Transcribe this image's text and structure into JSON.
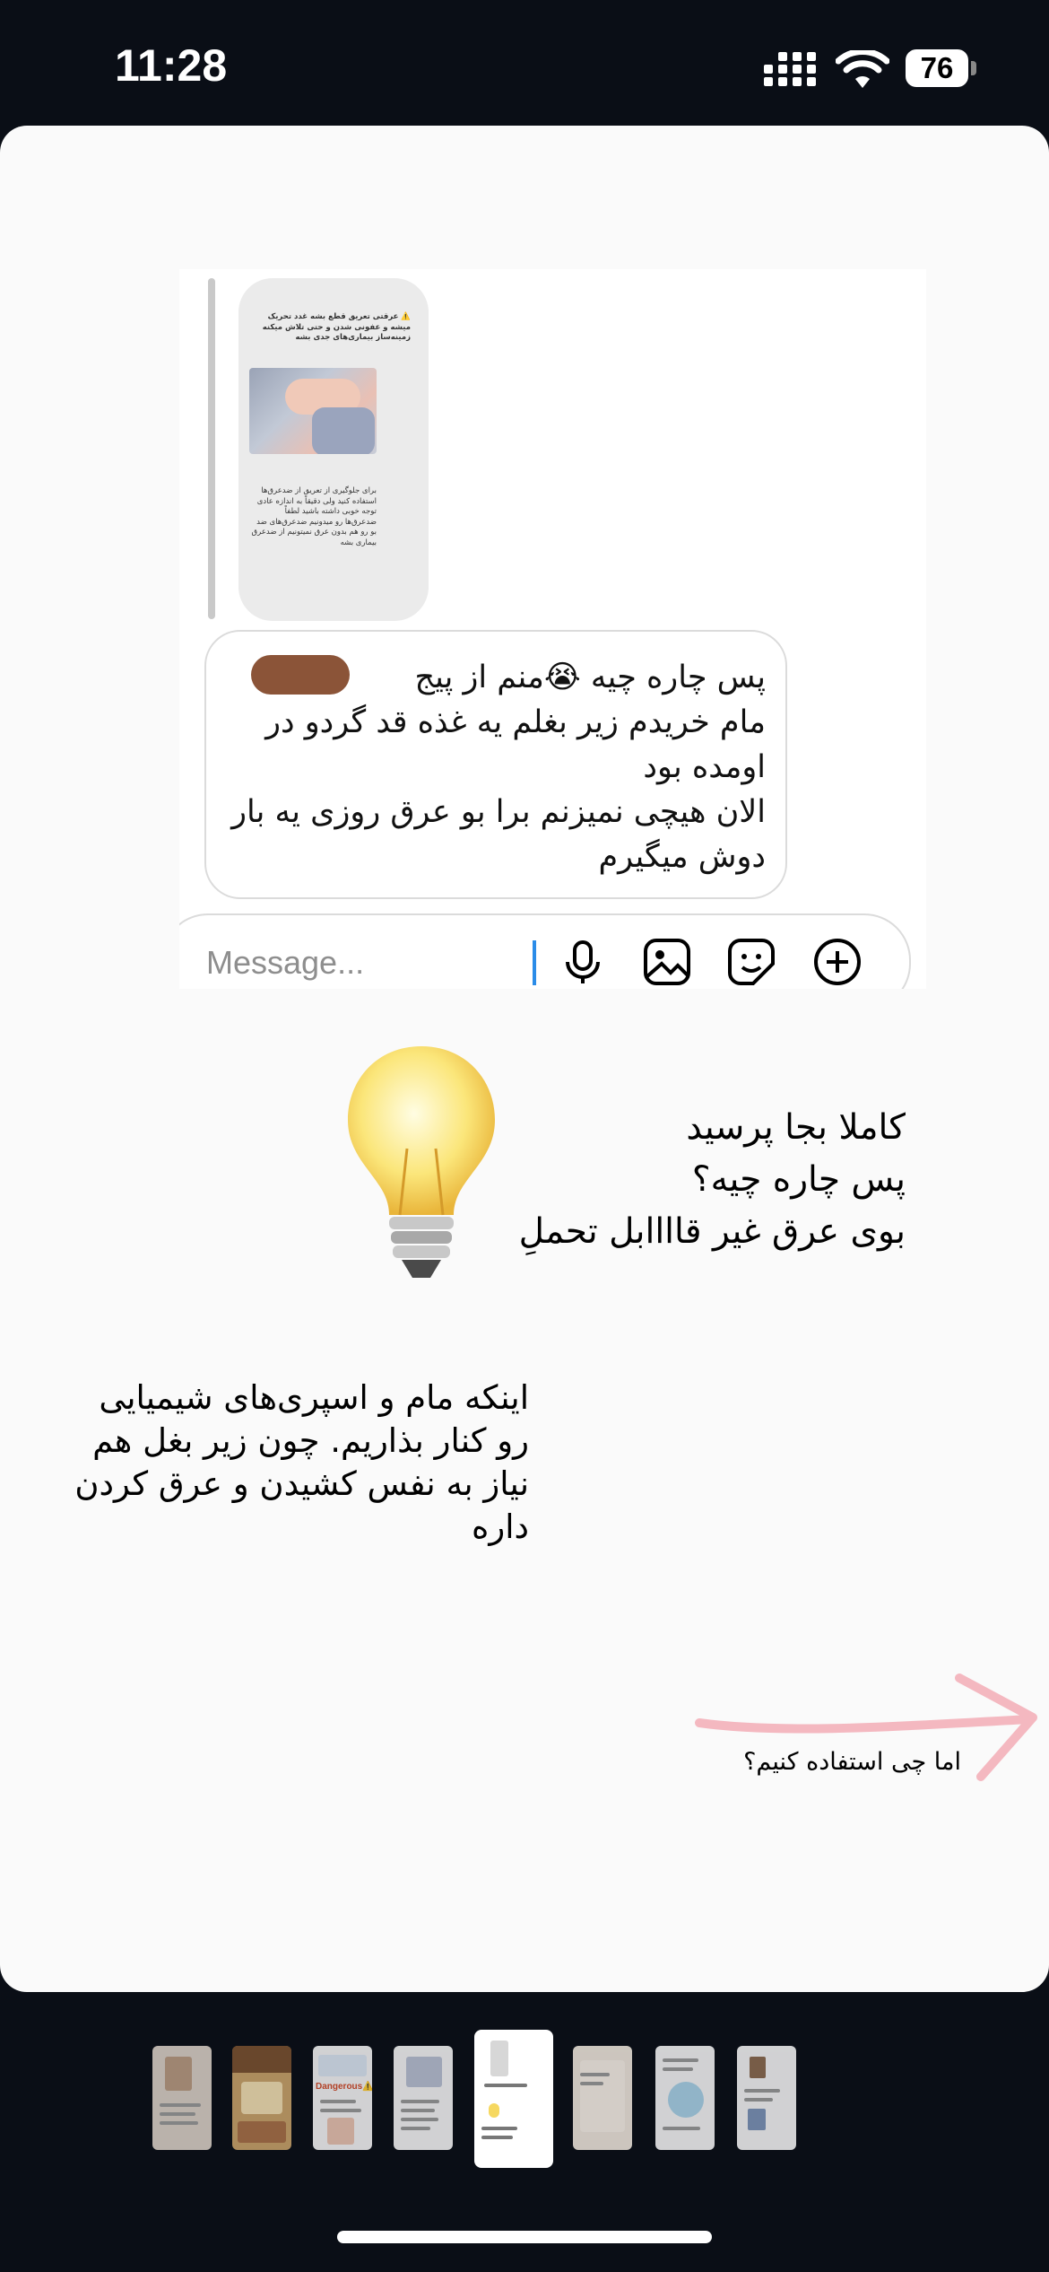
{
  "status_bar": {
    "time": "11:28",
    "battery": "76"
  },
  "screenshot": {
    "mini_post_top_text": "⚠️ عرقتی تعریق قطع بشه غدد تحریک میشه و عفونی شدن و حتی تلاش میکنه زمینه‌ساز بیماری‌های جدی بشه",
    "mini_post_bottom_text": "برای جلوگیری از تعریق از ضدعرق‌ها استفاده کنید ولی دقیقاً به اندازه عادی توجه خوبی داشته باشید لطفاً ضدعرق‌ها رو میدونیم ضدعرق‌های ضد بو رو هم بدون عرق نمیتونیم از ضدعرق بیماری بشه",
    "message_text": "پس چاره چیه 😭منم از پیج\nمام خریدم زیر بغلم یه غذه قد گردو در اومده بود\nالان هیچی نمیزنم برا بو عرق روزی یه بار دوش میگیرم",
    "composer_placeholder": "Message..."
  },
  "story": {
    "caption_1": "کاملا بجا پرسید\nپس چاره چیه؟\nبوی عرق غیر قاااابل تحملِ",
    "caption_2": "اینکه مام و اسپری‌های شیمیایی\nرو کنار بذاریم. چون زیر بغل هم\nنیاز به نفس کشیدن و عرق کردن\nداره",
    "caption_3": "اما چی استفاده کنیم؟",
    "thumbnail_labels": [
      "Dangerous⚠️"
    ]
  },
  "colors": {
    "arrow": "#f4b8c0",
    "caret": "#2b8ce8",
    "redaction": "#8b5438"
  }
}
